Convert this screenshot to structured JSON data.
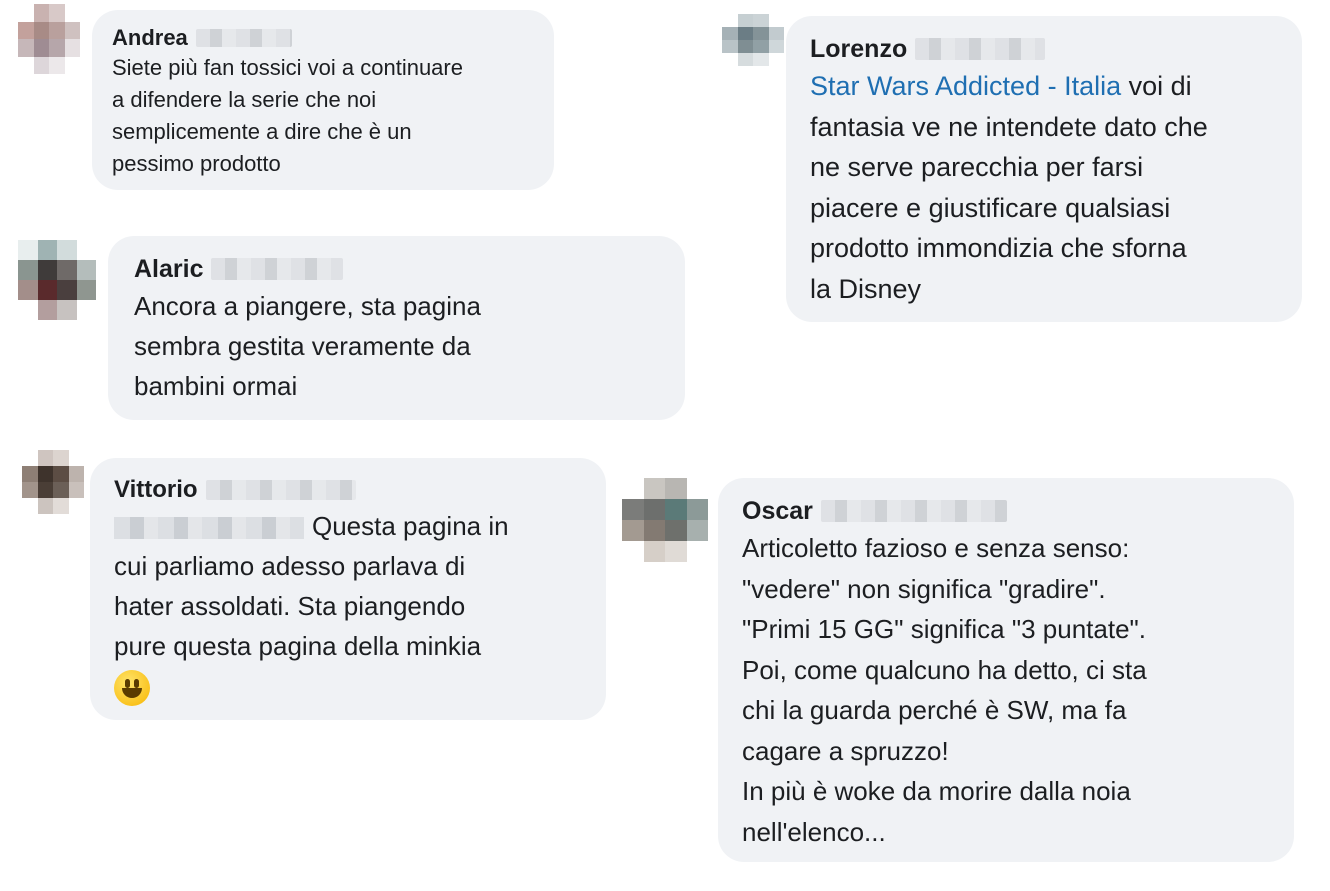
{
  "comments": [
    {
      "author": "Andrea",
      "lines": [
        "Siete più fan tossici voi a continuare",
        "a difendere la serie che noi",
        "semplicemente a dire che è un",
        "pessimo prodotto"
      ]
    },
    {
      "author": "Alaric",
      "lines": [
        "Ancora a piangere, sta pagina",
        "sembra gestita veramente da",
        "bambini ormai"
      ]
    },
    {
      "author": "Vittorio",
      "first_line": "Questa pagina in",
      "lines": [
        "cui parliamo adesso parlava di",
        "hater assoldati. Sta piangendo",
        "pure questa pagina della minkia"
      ],
      "emoji": "grinning-face-emoji"
    },
    {
      "author": "Lorenzo",
      "mention": "Star Wars Addicted - Italia",
      "first_line_rest": " voi di",
      "lines": [
        "fantasia ve ne intendete dato che",
        "ne serve parecchia per farsi",
        "piacere e giustificare qualsiasi",
        "prodotto immondizia che sforna",
        "la Disney"
      ]
    },
    {
      "author": "Oscar",
      "lines": [
        "Articoletto fazioso e senza senso:",
        "\"vedere\" non significa \"gradire\".",
        "\"Primi 15 GG\" significa \"3 puntate\".",
        "Poi, come qualcuno ha detto, ci sta",
        "chi la guarda perché è SW, ma fa",
        "cagare a spruzzo!",
        "In più è woke da morire dalla noia",
        "nell'elenco..."
      ]
    }
  ],
  "colors": {
    "bubble": "#f0f2f5",
    "mention": "#1f6fb2",
    "text": "#1c1e21"
  }
}
